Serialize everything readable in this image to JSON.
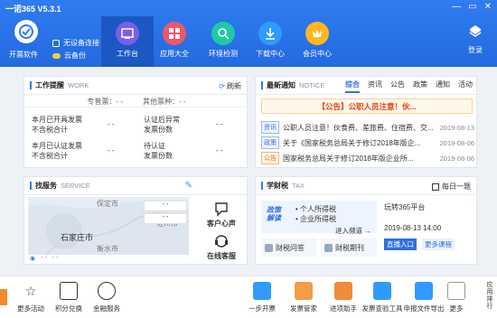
{
  "app": {
    "title": "一诺365 V5.3.1",
    "controls": [
      "—",
      "▭",
      "✕"
    ]
  },
  "header": {
    "open_software": "开票软件",
    "status_device": "无设备连接",
    "status_cloud": "云备份",
    "nav": [
      {
        "label": "工作台",
        "icon": "workbench-icon",
        "active": true
      },
      {
        "label": "应用大全",
        "icon": "apps-icon",
        "active": false
      },
      {
        "label": "环境检测",
        "icon": "env-check-icon",
        "active": false
      },
      {
        "label": "下载中心",
        "icon": "download-icon",
        "active": false
      },
      {
        "label": "会员中心",
        "icon": "member-icon",
        "active": false
      }
    ],
    "login": "登录"
  },
  "work": {
    "title": "工作提醒",
    "sub": "WORK",
    "refresh": "刷新",
    "special_label": "专普票：- -",
    "other_label": "其他票种：- -",
    "rows": [
      [
        "本月已开具发票",
        "不含税合计",
        "- -",
        "认证后异常",
        "发票份数",
        "- -"
      ],
      [
        "本月已认证发票",
        "不含税合计",
        "- -",
        "待认证",
        "发票份数",
        "- -"
      ]
    ]
  },
  "notice": {
    "title": "最新通知",
    "sub": "NOTICE",
    "tabs": [
      "综合",
      "资讯",
      "公告",
      "政策",
      "通知",
      "活动"
    ],
    "banner": "【公告】公职人员注意！伙...",
    "items": [
      {
        "tag": "资讯",
        "tag_color": "blue",
        "title": "公职人员注意！伙食费、差旅费、住宿费、交...",
        "date": "2019-08-13"
      },
      {
        "tag": "政策",
        "tag_color": "blue",
        "title": "关于《国家税务总局关于修订2018年版企...",
        "date": "2019-08-06"
      },
      {
        "tag": "公告",
        "tag_color": "orange",
        "title": "国家税务总局关于修订2018年版企业所...",
        "date": "2019-08-06"
      }
    ]
  },
  "service": {
    "title": "找服务",
    "sub": "SERVICE",
    "map_places": [
      "保定市",
      "沧州市",
      "石家庄市",
      "衡水市"
    ],
    "dashes": "- -",
    "customer_voice": "客户心声",
    "online_service": "在线客服"
  },
  "tax": {
    "title": "学财税",
    "sub": "TAX",
    "daily": "每日一题",
    "logo1": "政策",
    "logo2": "解读",
    "bullets": [
      "个人所得税",
      "企业所得税"
    ],
    "enter": "进入频道 →",
    "qa": "财税问答",
    "magazine": "财税期刊",
    "event_title": "玩转365平台",
    "event_date": "2019-08-13 14:00",
    "enter_live": "直播入口",
    "more_courses": "更多课程"
  },
  "footer": {
    "left": [
      "更多活动",
      "积分兑换",
      "金融服务"
    ],
    "right": [
      "一步开票",
      "发票管家",
      "进项助手",
      "发票查验工具",
      "申报文件导出",
      "更多"
    ],
    "rank": "应用排行"
  }
}
